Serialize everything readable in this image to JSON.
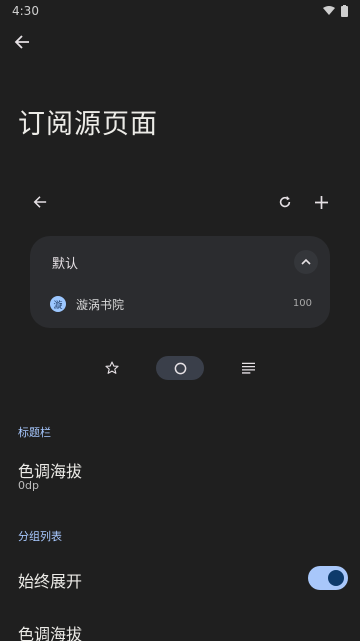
{
  "status_bar": {
    "time": "4:30"
  },
  "page": {
    "title": "订阅源页面"
  },
  "card": {
    "group_title": "默认",
    "source": {
      "avatar_letter": "漩",
      "name": "漩涡书院",
      "count": "100"
    }
  },
  "sections": [
    {
      "header": "标题栏",
      "prefs": [
        {
          "title": "色调海拔",
          "summary": "0dp"
        }
      ]
    },
    {
      "header": "分组列表",
      "prefs": [
        {
          "title": "始终展开",
          "switch_on": true
        },
        {
          "title": "色调海拔"
        }
      ]
    }
  ],
  "colors": {
    "accent": "#a8c7fa",
    "background": "#1f1f1f",
    "card": "#2b2c2f"
  },
  "icons": [
    "back-icon",
    "refresh-icon",
    "add-icon",
    "chevron-up-icon",
    "star-icon",
    "circle-icon",
    "list-icon",
    "wifi-icon",
    "battery-icon"
  ]
}
